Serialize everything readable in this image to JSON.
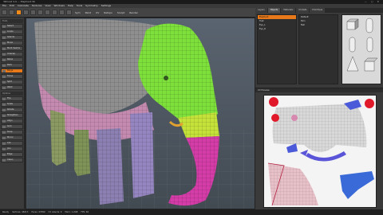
{
  "app": {
    "title": "3DCoat 4.9 — Elephant.3b",
    "win_controls": "— ▢ ✕"
  },
  "menu": [
    "File",
    "Edit",
    "Calculate",
    "Textures",
    "View",
    "Windows",
    "Help",
    "Tools",
    "Symmetry",
    "Settings"
  ],
  "toolbar": {
    "labels": [
      "Sym",
      "Paint",
      "UV",
      "Retopo",
      "Sculpt",
      "Render"
    ]
  },
  "left_panel": {
    "head1": "Tools",
    "items": [
      "Select",
      "Loops",
      "Islands",
      "Move",
      "Mark Seams",
      "Unwrap",
      "Relax",
      "Pack",
      "Rings",
      "Faces",
      "Split",
      "Weld",
      "Flip",
      "Scale",
      "Rotate",
      "Straighten",
      "Align",
      "Grid",
      "Snap",
      "Mirror",
      "Cut",
      "Join",
      "Edge",
      "Clean"
    ],
    "head2": "Options",
    "highlighted_index": 8
  },
  "right_top": {
    "tabs": [
      "Layers",
      "Objects",
      "Materials",
      "UV-Sets",
      "Primitives"
    ],
    "objects": [
      "Elephant",
      "Tusk",
      "Eye_L",
      "Eye_R"
    ],
    "materials": [
      "Default",
      "Skin",
      "Nail"
    ],
    "selected_object": 0
  },
  "uv_panel": {
    "title": "UV Preview"
  },
  "status": [
    "Ready",
    "Vertices: 48213",
    "Faces: 47890",
    "UV islands: 9",
    "Mem: 1.2GB",
    "FPS: 60"
  ]
}
